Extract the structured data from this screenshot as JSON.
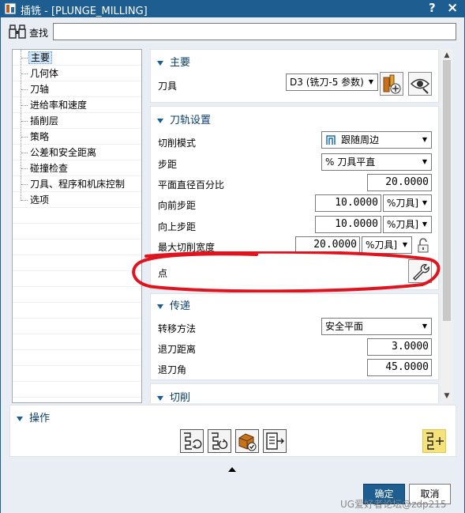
{
  "window": {
    "title": "插铣 - [PLUNGE_MILLING]",
    "help": "?",
    "close": "×"
  },
  "search": {
    "label": "查找",
    "value": ""
  },
  "tree": {
    "items": [
      {
        "label": "主要",
        "selected": true
      },
      {
        "label": "几何体"
      },
      {
        "label": "刀轴"
      },
      {
        "label": "进给率和速度"
      },
      {
        "label": "插削层"
      },
      {
        "label": "策略"
      },
      {
        "label": "公差和安全距离"
      },
      {
        "label": "碰撞检查"
      },
      {
        "label": "刀具、程序和机床控制"
      },
      {
        "label": "选项"
      }
    ]
  },
  "main_section": {
    "header": "主要",
    "tool_label": "刀具",
    "tool_value": "D3 (铣刀-5 参数)"
  },
  "toolpath_section": {
    "header": "刀轨设置",
    "cut_pattern_label": "切削模式",
    "cut_pattern_value": "跟随周边",
    "stepover_label": "步距",
    "stepover_value": "% 刀具平直",
    "flat_diameter_label": "平面直径百分比",
    "flat_diameter_value": "20.0000",
    "forward_step_label": "向前步距",
    "forward_step_value": "10.0000",
    "forward_step_unit": "%刀具]",
    "up_step_label": "向上步距",
    "up_step_value": "10.0000",
    "up_step_unit": "%刀具]",
    "max_cut_width_label": "最大切削宽度",
    "max_cut_width_value": "20.0000",
    "max_cut_width_unit": "%刀具]",
    "point_label": "点"
  },
  "transfer_section": {
    "header": "传递",
    "transfer_method_label": "转移方法",
    "transfer_method_value": "安全平面",
    "retract_distance_label": "退刀距离",
    "retract_distance_value": "3.0000",
    "retract_angle_label": "退刀角",
    "retract_angle_value": "45.0000"
  },
  "cut_section": {
    "header": "切削"
  },
  "operations": {
    "header": "操作"
  },
  "buttons": {
    "ok": "确定",
    "cancel": "取消"
  },
  "watermark": "UG爱好者论坛@zdp215",
  "colors": {
    "titlebar": "#1e5d8f",
    "highlight_circle": "#e0141e",
    "operation_highlight": "#f6e27a"
  }
}
